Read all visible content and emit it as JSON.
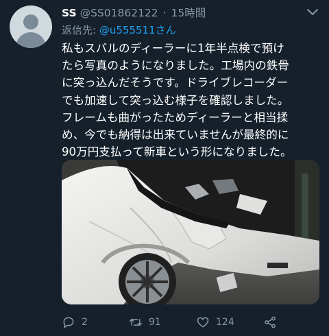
{
  "tweet": {
    "display_name": "SS",
    "handle": "@SS01862122",
    "separator": "·",
    "time": "15時間",
    "reply_prefix": "返信先:",
    "reply_mention": "@u555511さん",
    "text": "私もスバルのディーラーに1年半点検で預け\nたら写真のようになりました。工場内の鉄骨\nに突っ込んだそうです。ドライブレコーダー\nでも加速して突っ込む様子を確認しました。\nフレームも曲がったためディーラーと相当揉\nめ、今でも納得は出来ていませんが最終的に\n90万円支払って新車という形になりました。"
  },
  "media": {
    "description_icon": "photo-crashed-white-car-front"
  },
  "actions": {
    "reply_count": "2",
    "retweet_count": "91",
    "like_count": "124"
  },
  "colors": {
    "background": "#15202b",
    "text": "#ffffff",
    "muted": "#8899a6",
    "link": "#1da1f2"
  }
}
